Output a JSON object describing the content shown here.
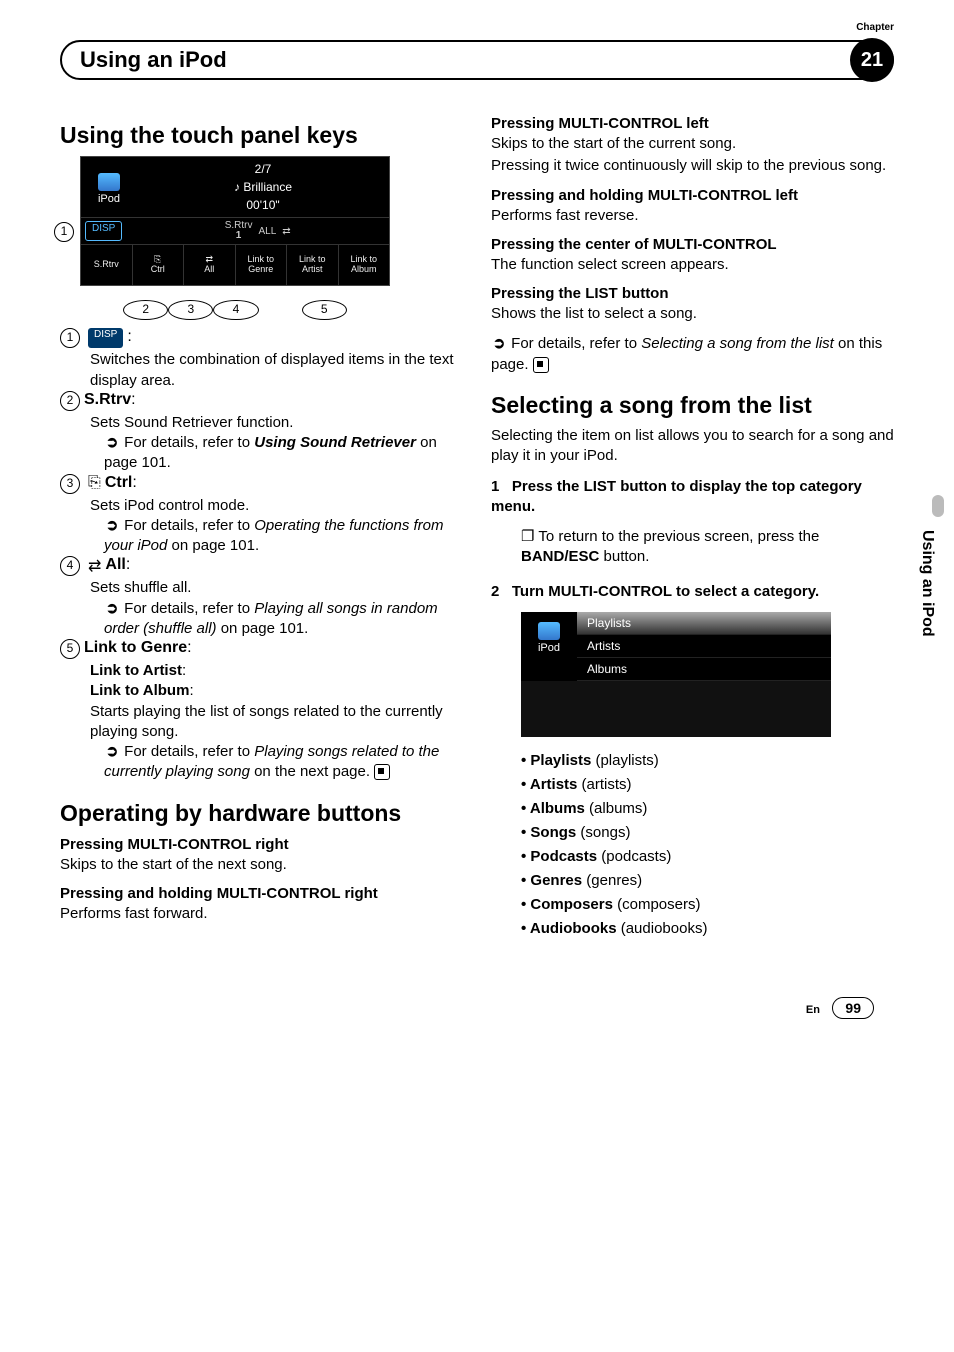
{
  "header": {
    "chapter_label": "Chapter",
    "title": "Using an iPod",
    "chapter_number": "21"
  },
  "side_tab": "Using an iPod",
  "footer": {
    "lang": "En",
    "page": "99"
  },
  "left": {
    "h_touch": "Using the touch panel keys",
    "shot1": {
      "ipod": "iPod",
      "counter": "2/7",
      "song": "Brilliance",
      "time": "00'10\"",
      "disp": "DISP",
      "srtrv_small": "S.Rtrv",
      "one": "1",
      "all_small": "ALL",
      "shuffle": "✕",
      "btn_srtrv": "S.Rtrv",
      "btn_ctrl": "Ctrl",
      "btn_all": "All",
      "btn_link_genre_l1": "Link to",
      "btn_link_genre_l2": "Genre",
      "btn_link_artist_l1": "Link to",
      "btn_link_artist_l2": "Artist",
      "btn_link_album_l1": "Link to",
      "btn_link_album_l2": "Album",
      "c1": "1",
      "c2": "2",
      "c3": "3",
      "c4": "4",
      "c5": "5"
    },
    "items": {
      "i1_text": "Switches the combination of displayed items in the text display area.",
      "i2_head": "S.Rtrv",
      "i2_text": "Sets Sound Retriever function.",
      "i2_ref_prefix": "For details, refer to ",
      "i2_ref_link": "Using Sound Retriever",
      "i2_ref_suffix": " on page 101.",
      "i3_head": "Ctrl",
      "i3_text": "Sets iPod control mode.",
      "i3_ref_prefix": "For details, refer to ",
      "i3_ref_link": "Operating the functions from your iPod",
      "i3_ref_suffix": " on page 101.",
      "i4_head": "All",
      "i4_text": "Sets shuffle all.",
      "i4_ref_prefix": "For details, refer to ",
      "i4_ref_link": "Playing all songs in random order (shuffle all)",
      "i4_ref_suffix": " on page 101.",
      "i5_h1": "Link to Genre",
      "i5_h2": "Link to Artist",
      "i5_h3": "Link to Album",
      "i5_text": "Starts playing the list of songs related to the currently playing song.",
      "i5_ref_prefix": "For details, refer to ",
      "i5_ref_link": "Playing songs related to the currently playing song",
      "i5_ref_suffix": " on the next page."
    },
    "h_hardware": "Operating by hardware buttons",
    "hw": {
      "h1a": "Pressing ",
      "h1b": "MULTI-CONTROL",
      "h1c": " right",
      "t1": "Skips to the start of the next song.",
      "h2a": "Pressing and holding ",
      "h2b": "MULTI-CONTROL",
      "h2c": " right",
      "t2": "Performs fast forward."
    }
  },
  "right": {
    "hw": {
      "h3a": "Pressing ",
      "h3b": "MULTI-CONTROL",
      "h3c": " left",
      "t3a": "Skips to the start of the current song.",
      "t3b": "Pressing it twice continuously will skip to the previous song.",
      "h4a": "Pressing and holding ",
      "h4b": "MULTI-CONTROL",
      "h4c": " left",
      "t4": "Performs fast reverse.",
      "h5a": "Pressing the center of ",
      "h5b": "MULTI-CONTROL",
      "t5": "The function select screen appears.",
      "h6a": "Pressing the ",
      "h6b": "LIST",
      "h6c": " button",
      "t6": "Shows the list to select a song.",
      "t6_ref_prefix": "For details, refer to ",
      "t6_ref_link": "Selecting a song from the list",
      "t6_ref_suffix": " on this page."
    },
    "h_select": "Selecting a song from the list",
    "select_intro": "Selecting the item on list allows you to search for a song and play it in your iPod.",
    "step1_num": "1",
    "step1": "Press the LIST button to display the top category menu.",
    "step1_note_pre": "To return to the previous screen, press the ",
    "step1_note_btn": "BAND/ESC",
    "step1_note_post": " button.",
    "step2_num": "2",
    "step2": "Turn MULTI-CONTROL to select a category.",
    "shot2": {
      "ipod": "iPod",
      "l1": "Playlists",
      "l2": "Artists",
      "l3": "Albums"
    },
    "cats": {
      "c1a": "Playlists",
      "c1b": " (playlists)",
      "c2a": "Artists",
      "c2b": " (artists)",
      "c3a": "Albums",
      "c3b": " (albums)",
      "c4a": "Songs",
      "c4b": " (songs)",
      "c5a": "Podcasts",
      "c5b": " (podcasts)",
      "c6a": "Genres",
      "c6b": " (genres)",
      "c7a": "Composers",
      "c7b": " (composers)",
      "c8a": "Audiobooks",
      "c8b": " (audiobooks)"
    }
  }
}
